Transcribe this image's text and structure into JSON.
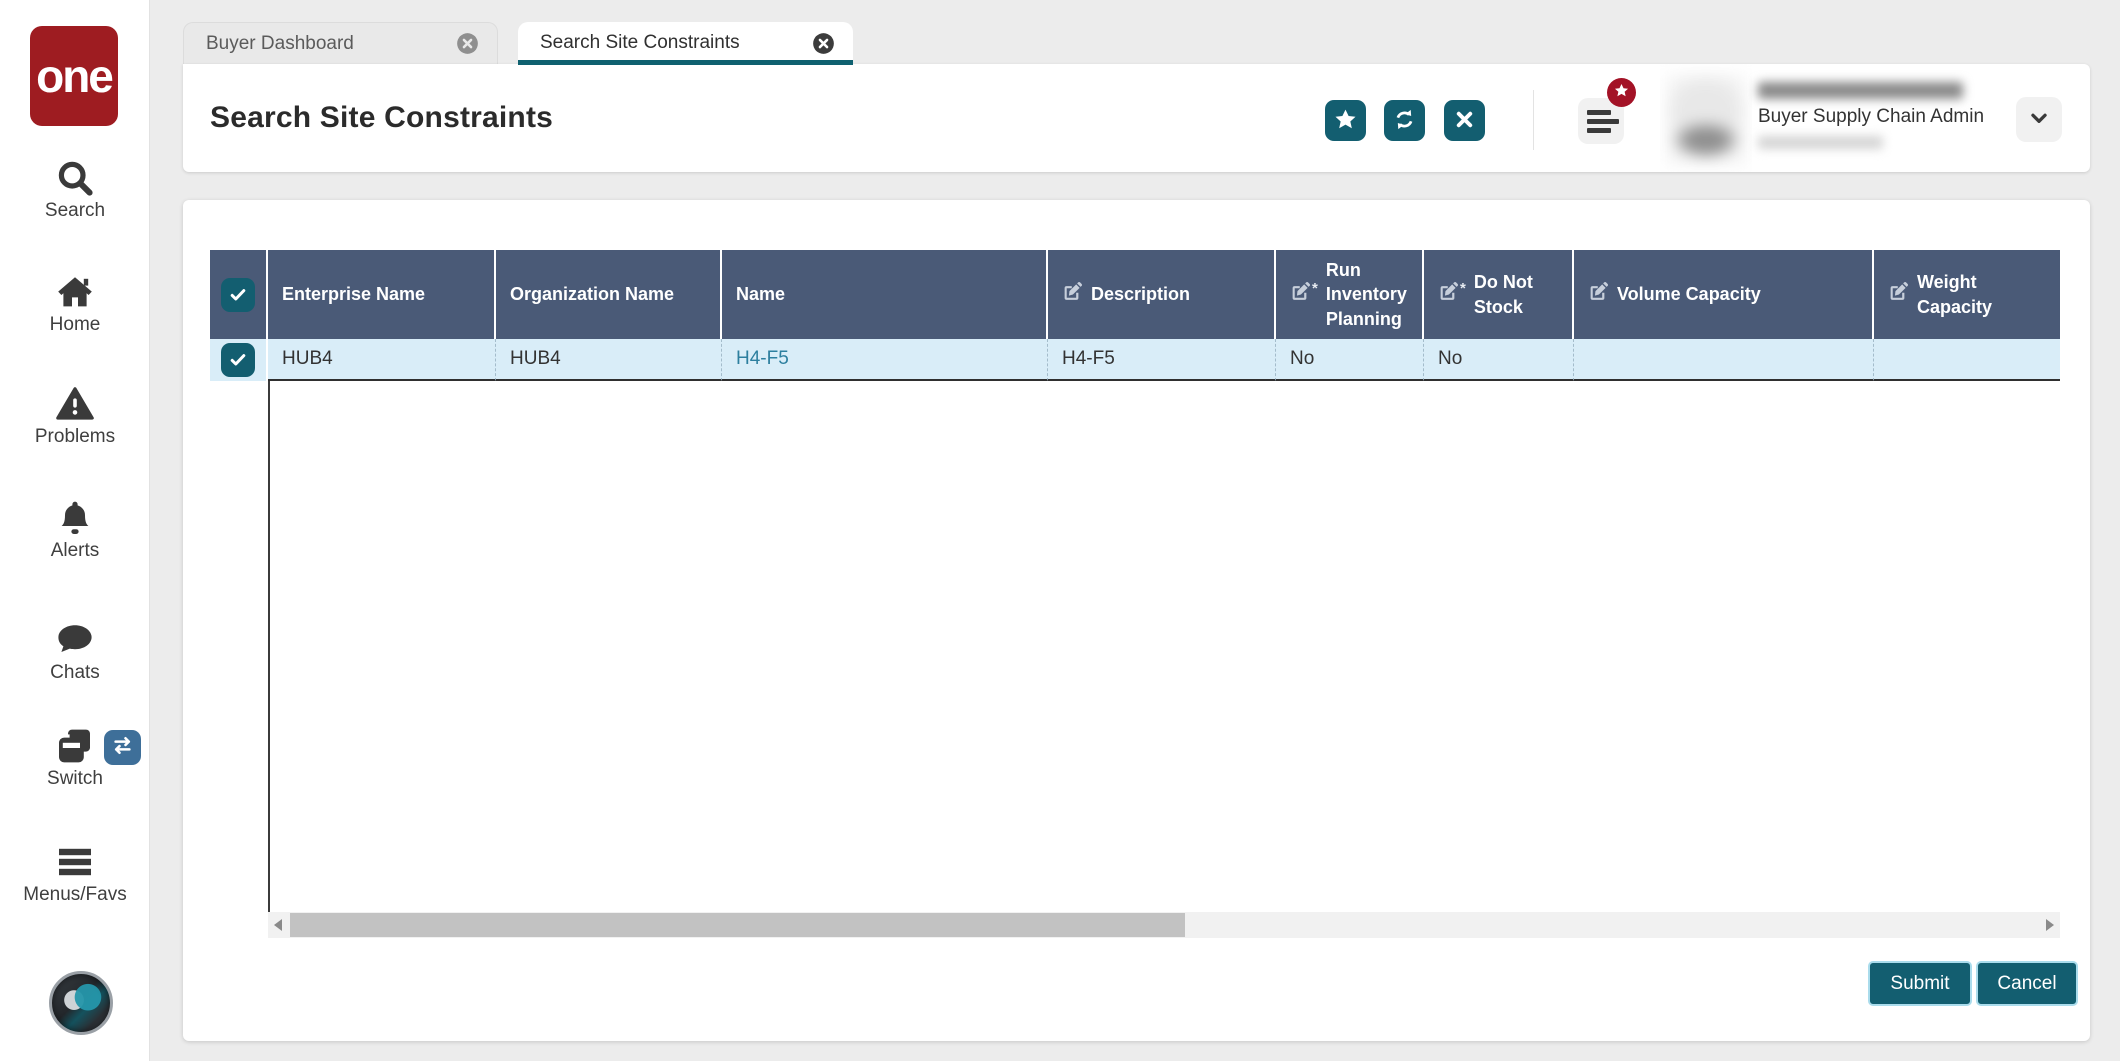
{
  "logo": {
    "text": "one"
  },
  "sidebar": {
    "items": [
      {
        "label": "Search"
      },
      {
        "label": "Home"
      },
      {
        "label": "Problems"
      },
      {
        "label": "Alerts"
      },
      {
        "label": "Chats"
      },
      {
        "label": "Switch"
      },
      {
        "label": "Menus/Favs"
      }
    ]
  },
  "tabs": [
    {
      "label": "Buyer Dashboard",
      "active": false
    },
    {
      "label": "Search Site Constraints",
      "active": true
    }
  ],
  "page": {
    "title": "Search Site Constraints",
    "user": {
      "role": "Buyer Supply Chain Admin"
    }
  },
  "table": {
    "columns": [
      {
        "label": ""
      },
      {
        "label": "Enterprise Name"
      },
      {
        "label": "Organization Name"
      },
      {
        "label": "Name"
      },
      {
        "label": "Description",
        "icon": "edit-icon"
      },
      {
        "label": "Run Inventory Planning",
        "icon": "edit-icon",
        "required_marker": "*"
      },
      {
        "label": "Do Not Stock",
        "icon": "edit-icon",
        "required_marker": "*"
      },
      {
        "label": "Volume Capacity",
        "icon": "edit-icon"
      },
      {
        "label": "Weight Capacity",
        "icon": "edit-icon"
      }
    ],
    "rows": [
      {
        "selected": true,
        "enterprise_name": "HUB4",
        "organization_name": "HUB4",
        "name": "H4-F5",
        "description": "H4-F5",
        "run_inventory_planning": "No",
        "do_not_stock": "No",
        "volume_capacity": "",
        "weight_capacity": ""
      }
    ]
  },
  "footer": {
    "submit": "Submit",
    "cancel": "Cancel"
  },
  "colors": {
    "teal": "#135e70",
    "table_header_bg": "#4a5a77",
    "row_bg": "#d9edf8",
    "link": "#2d7f9f",
    "logo_red": "#9e1c21",
    "badge_red": "#a31226",
    "switch_badge_blue": "#3e6f99",
    "tab_underline": "#0f6170"
  }
}
